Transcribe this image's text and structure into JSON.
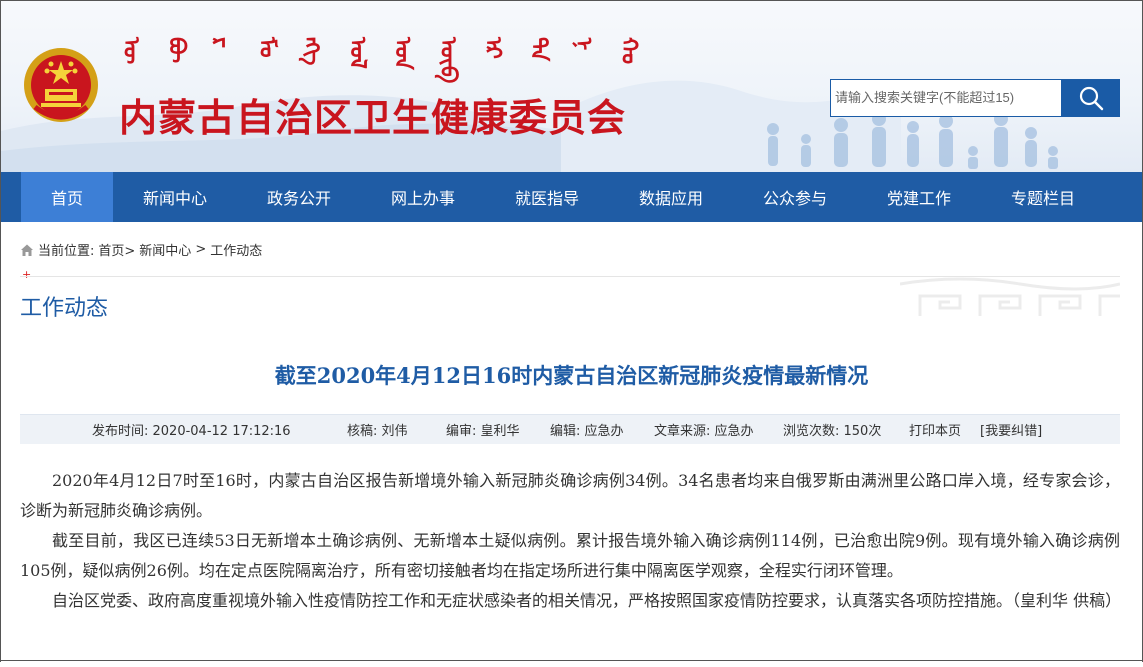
{
  "header": {
    "mongol_script": [
      "ᠦ",
      "ᠪᠥ",
      "ᠷ",
      "ᠮᠣ",
      "ᠩᠭ",
      "ᠤᠯ",
      "ᠤᠨ",
      "ᠥᠪ",
      "ᠡᠷ",
      "ᠲᠡ",
      "ᠨ",
      "ᠬᠣ"
    ],
    "site_title": "内蒙古自治区卫生健康委员会",
    "search_placeholder": "请输入搜索关键字(不能超过15)",
    "search_icon": "search-icon",
    "title_color": "#c9151e"
  },
  "nav": {
    "items": [
      {
        "label": "首页",
        "active": true
      },
      {
        "label": "新闻中心",
        "active": false
      },
      {
        "label": "政务公开",
        "active": false
      },
      {
        "label": "网上办事",
        "active": false
      },
      {
        "label": "就医指导",
        "active": false
      },
      {
        "label": "数据应用",
        "active": false
      },
      {
        "label": "公众参与",
        "active": false
      },
      {
        "label": "党建工作",
        "active": false
      },
      {
        "label": "专题栏目",
        "active": false
      }
    ],
    "bg_color": "#1f5ca5",
    "active_color": "#3d7fd6"
  },
  "breadcrumb": {
    "prefix": "当前位置:",
    "home": "首页>",
    "news": "新闻中心",
    "sep": ">",
    "current": "工作动态"
  },
  "section": {
    "mark": "+",
    "title": "工作动态"
  },
  "article": {
    "title": "截至2020年4月12日16时内蒙古自治区新冠肺炎疫情最新情况",
    "meta": {
      "publish_time": "发布时间:  2020-04-12 17:12:16",
      "author": "核稿:  刘伟",
      "editor_in_chief": "编审:  皇利华",
      "editor": "编辑:  应急办",
      "source": "文章来源:  应急办",
      "views": "浏览次数:  150次",
      "print": "打印本页",
      "report_error": "[我要纠错]"
    },
    "paragraphs": [
      "2020年4月12日7时至16时，内蒙古自治区报告新增境外输入新冠肺炎确诊病例34例。34名患者均来自俄罗斯由满洲里公路口岸入境，经专家会诊，诊断为新冠肺炎确诊病例。",
      "截至目前，我区已连续53日无新增本土确诊病例、无新增本土疑似病例。累计报告境外输入确诊病例114例，已治愈出院9例。现有境外输入确诊病例105例，疑似病例26例。均在定点医院隔离治疗，所有密切接触者均在指定场所进行集中隔离医学观察，全程实行闭环管理。",
      "自治区党委、政府高度重视境外输入性疫情防控工作和无症状感染者的相关情况，严格按照国家疫情防控要求，认真落实各项防控措施。（皇利华 供稿）"
    ]
  }
}
